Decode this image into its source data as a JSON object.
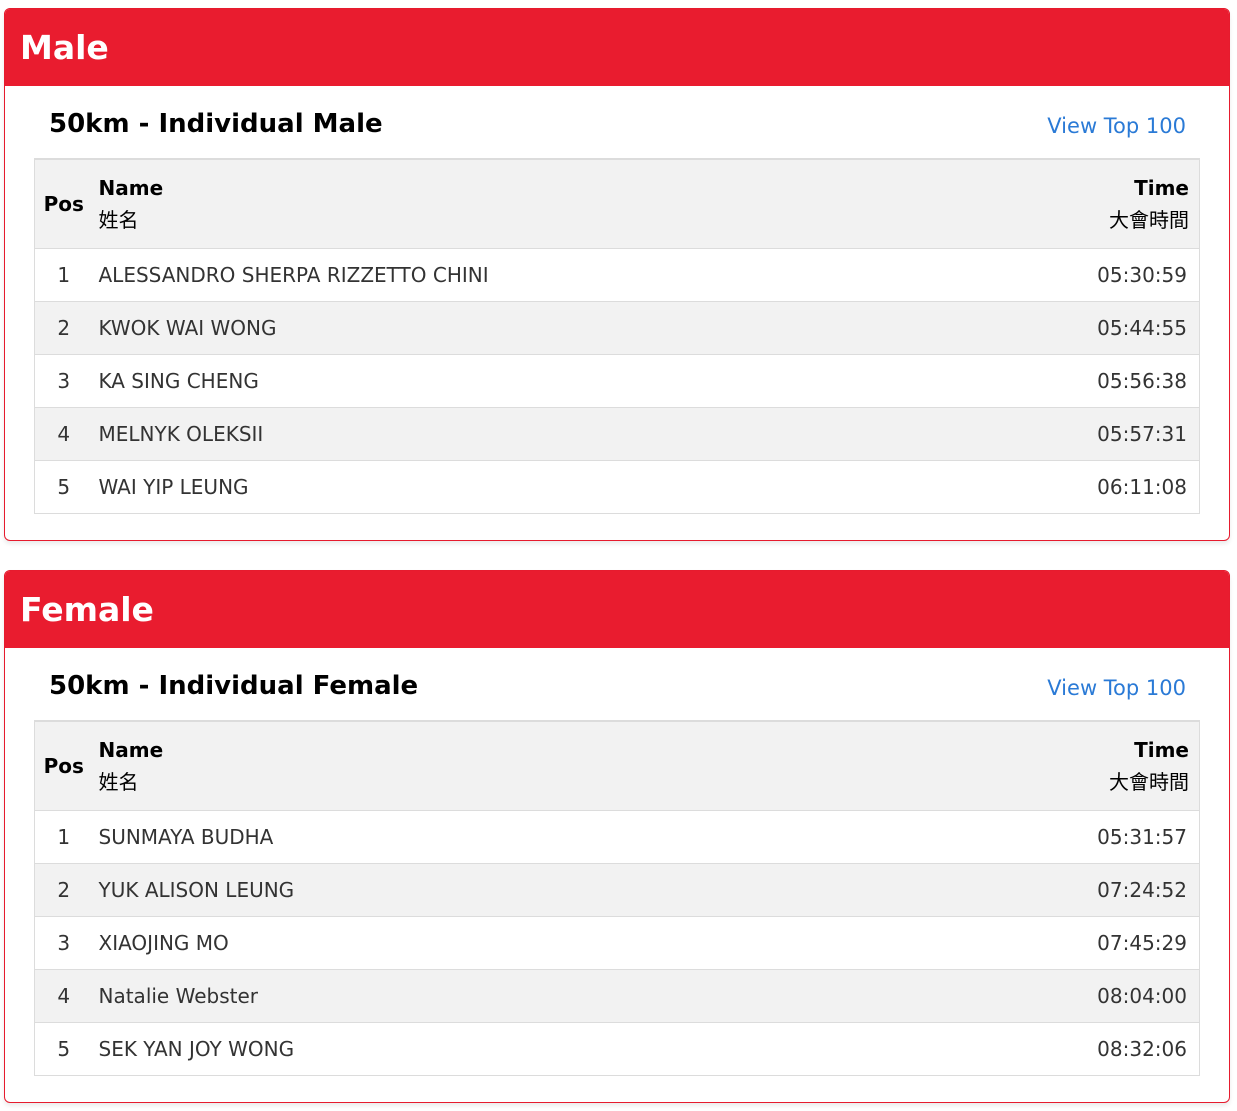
{
  "male": {
    "header": "Male",
    "event_title": "50km - Individual Male",
    "top_link": "View Top 100",
    "columns": {
      "pos": "Pos",
      "name": "Name",
      "name_sub": "姓名",
      "time": "Time",
      "time_sub": "大會時間"
    },
    "rows": [
      {
        "pos": "1",
        "name": "ALESSANDRO SHERPA RIZZETTO CHINI",
        "time": "05:30:59"
      },
      {
        "pos": "2",
        "name": "KWOK WAI WONG",
        "time": "05:44:55"
      },
      {
        "pos": "3",
        "name": "KA SING CHENG",
        "time": "05:56:38"
      },
      {
        "pos": "4",
        "name": "MELNYK OLEKSII",
        "time": "05:57:31"
      },
      {
        "pos": "5",
        "name": "WAI YIP LEUNG",
        "time": "06:11:08"
      }
    ]
  },
  "female": {
    "header": "Female",
    "event_title": "50km - Individual Female",
    "top_link": "View Top 100",
    "columns": {
      "pos": "Pos",
      "name": "Name",
      "name_sub": "姓名",
      "time": "Time",
      "time_sub": "大會時間"
    },
    "rows": [
      {
        "pos": "1",
        "name": "SUNMAYA BUDHA",
        "time": "05:31:57"
      },
      {
        "pos": "2",
        "name": "YUK ALISON LEUNG",
        "time": "07:24:52"
      },
      {
        "pos": "3",
        "name": "XIAOJING MO",
        "time": "07:45:29"
      },
      {
        "pos": "4",
        "name": "Natalie Webster",
        "time": "08:04:00"
      },
      {
        "pos": "5",
        "name": "SEK YAN JOY WONG",
        "time": "08:32:06"
      }
    ]
  },
  "colors": {
    "accent": "#e91c2f",
    "link": "#2a7ad6",
    "stripe": "#f2f2f2"
  }
}
